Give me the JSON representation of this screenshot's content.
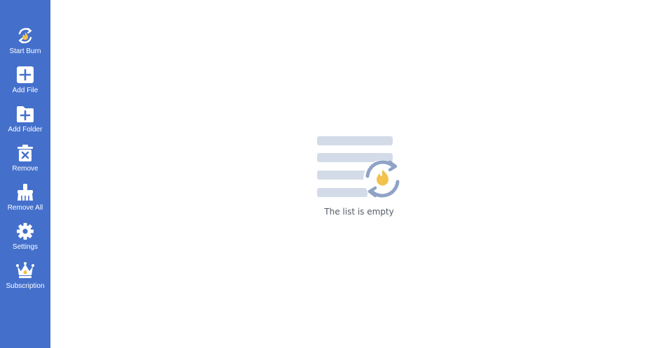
{
  "sidebar": {
    "items": [
      {
        "label": "Start Burn",
        "icon": "start-burn-icon"
      },
      {
        "label": "Add File",
        "icon": "add-file-icon"
      },
      {
        "label": "Add Folder",
        "icon": "add-folder-icon"
      },
      {
        "label": "Remove",
        "icon": "remove-icon"
      },
      {
        "label": "Remove All",
        "icon": "remove-all-icon"
      },
      {
        "label": "Settings",
        "icon": "gear-icon"
      },
      {
        "label": "Subscription",
        "icon": "crown-icon"
      }
    ]
  },
  "main": {
    "empty_state": {
      "text": "The list is empty",
      "icon": "empty-list-icon"
    }
  },
  "colors": {
    "sidebar_bg": "#4470cc",
    "accent_flame": "#f2c14e",
    "illustration_lines": "#d3dbe8",
    "illustration_arrows": "#8fa3c6"
  }
}
